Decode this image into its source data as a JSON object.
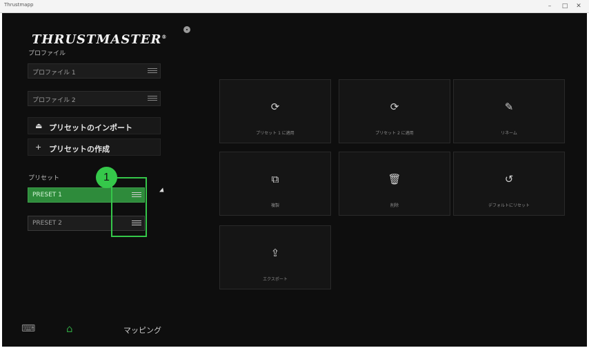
{
  "window": {
    "title": "Thrustmapp",
    "minimize_label": "–",
    "maximize_label": "□",
    "close_label": "✕"
  },
  "brand": {
    "logo_text": "THRUSTMASTER",
    "logo_mark": "®"
  },
  "profiles": {
    "section_label": "プロファイル",
    "items": [
      {
        "label": "プロファイル 1"
      },
      {
        "label": "プロファイル 2"
      }
    ]
  },
  "actions": [
    {
      "icon": "import-icon",
      "glyph": "⏏",
      "label": "プリセットのインポート"
    },
    {
      "icon": "plus-icon",
      "glyph": "+",
      "label": "プリセットの作成"
    }
  ],
  "presets": {
    "section_label": "プリセット",
    "items": [
      {
        "label": "PRESET 1",
        "active": true
      },
      {
        "label": "PRESET 2",
        "active": false
      }
    ]
  },
  "annotation": {
    "badge_number": "1",
    "color": "#35c84a"
  },
  "tiles": [
    {
      "icon": "sync-icon",
      "glyph": "⟳",
      "label": "プリセット 1 に適用"
    },
    {
      "icon": "sync-icon",
      "glyph": "⟳",
      "label": "プリセット 2 に適用"
    },
    {
      "icon": "edit-icon",
      "glyph": "✎",
      "label": "リネーム"
    },
    {
      "icon": "copy-icon",
      "glyph": "⧉",
      "label": "複製"
    },
    {
      "icon": "trash-icon",
      "glyph": "🗑",
      "label": "削除"
    },
    {
      "icon": "reset-icon",
      "glyph": "↺",
      "label": "デフォルトにリセット"
    },
    {
      "icon": "export-icon",
      "glyph": "⇪",
      "label": "エクスポート"
    }
  ],
  "bottom_nav": {
    "device_glyph": "⌨",
    "home_glyph": "⌂",
    "mapping_label": "マッピング"
  },
  "colors": {
    "accent_green": "#2e8b3b",
    "background": "#0e0e0e"
  }
}
